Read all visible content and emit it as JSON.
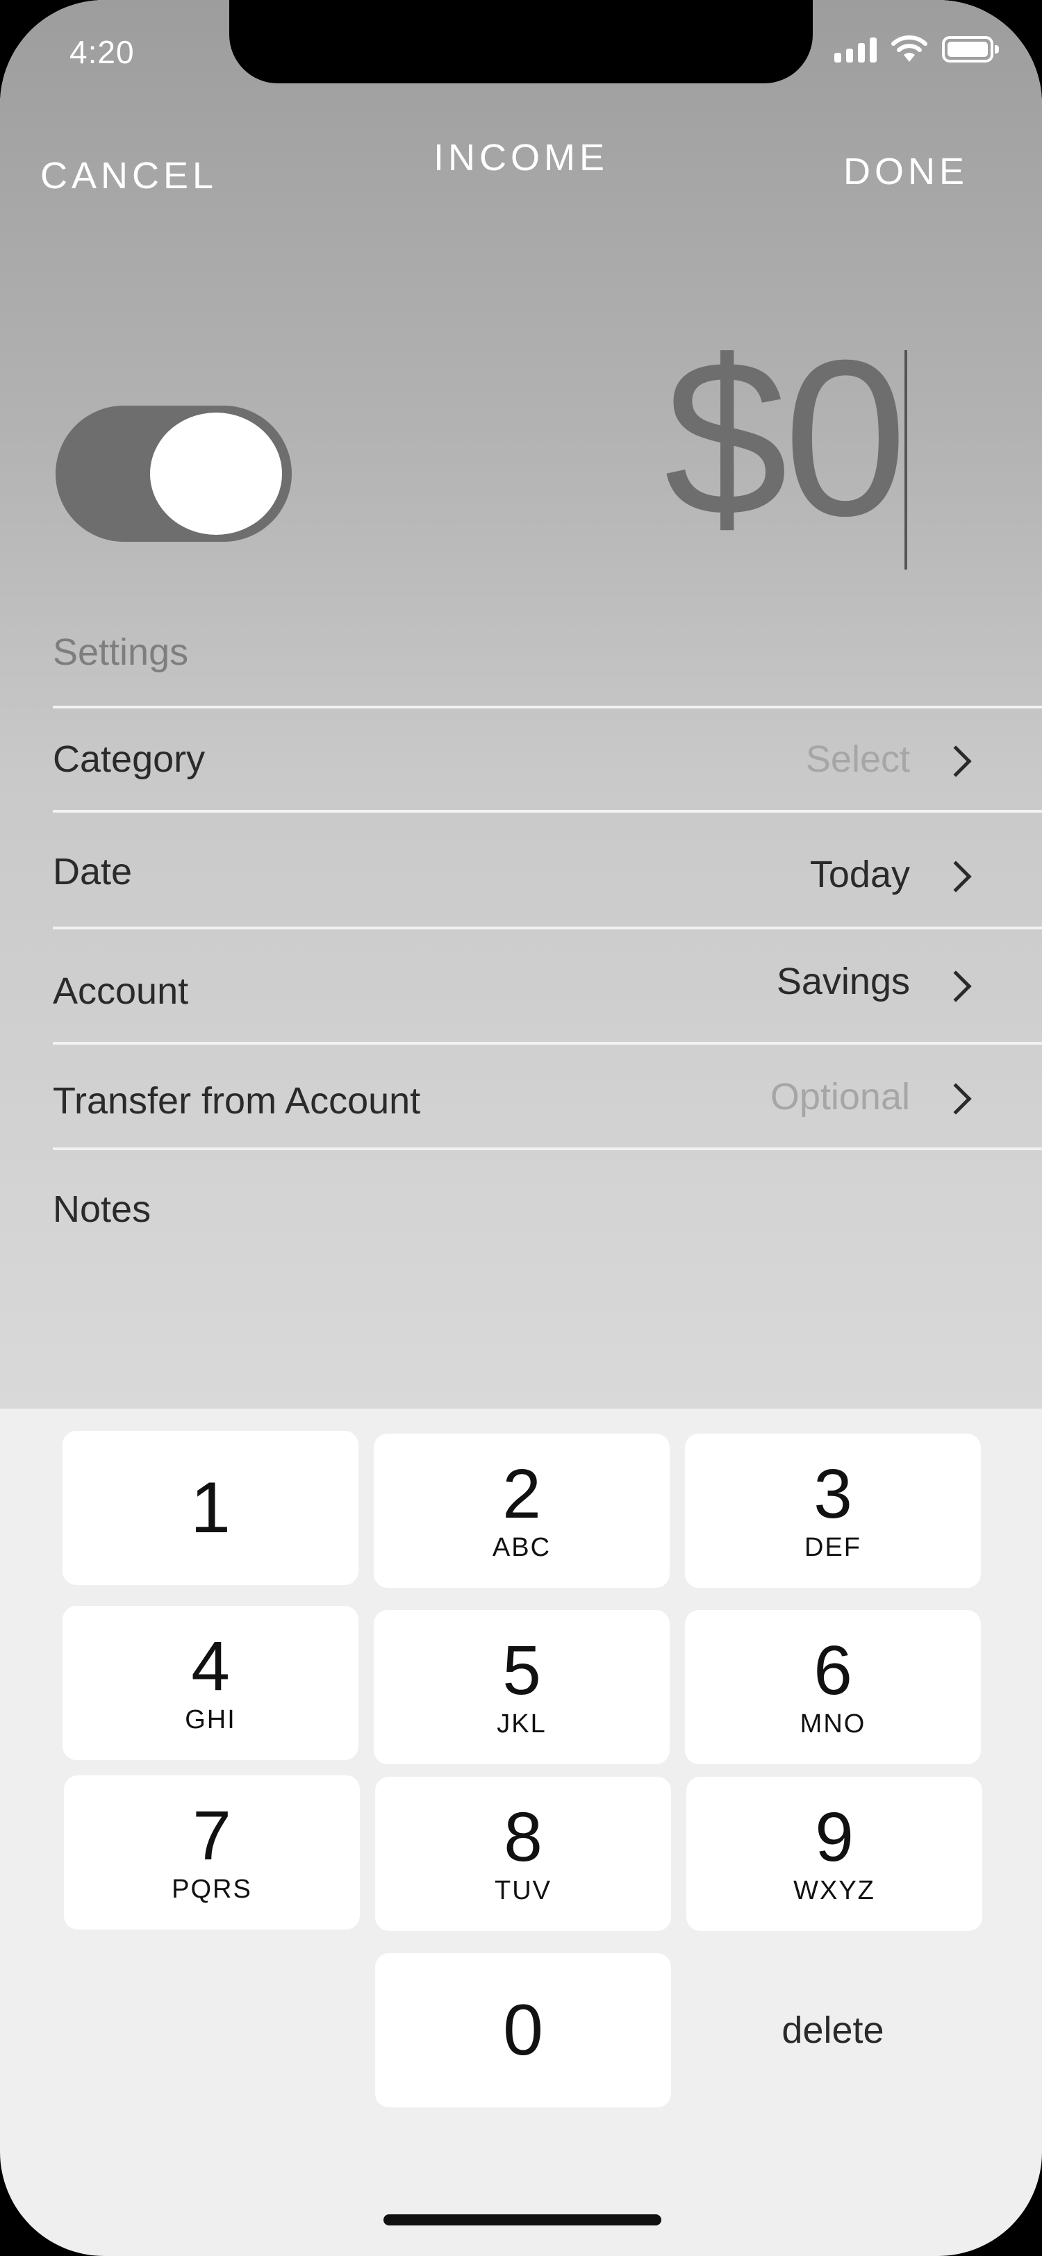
{
  "status_bar": {
    "time": "4:20",
    "icons": [
      "signal-icon",
      "wifi-icon",
      "battery-icon"
    ]
  },
  "header": {
    "cancel": "CANCEL",
    "title": "INCOME",
    "done": "DONE"
  },
  "toggle": {
    "state": "on"
  },
  "amount": "$0",
  "settings": {
    "label": "Settings",
    "rows": [
      {
        "label": "Category",
        "value": "Select",
        "placeholder": true
      },
      {
        "label": "Date",
        "value": "Today",
        "placeholder": false
      },
      {
        "label": "Account",
        "value": "Savings",
        "placeholder": false
      },
      {
        "label": "Transfer from Account",
        "value": "Optional",
        "placeholder": true
      }
    ],
    "notes_label": "Notes"
  },
  "keypad": {
    "keys": [
      {
        "num": "1",
        "letters": ""
      },
      {
        "num": "2",
        "letters": "ABC"
      },
      {
        "num": "3",
        "letters": "DEF"
      },
      {
        "num": "4",
        "letters": "GHI"
      },
      {
        "num": "5",
        "letters": "JKL"
      },
      {
        "num": "6",
        "letters": "MNO"
      },
      {
        "num": "7",
        "letters": "PQRS"
      },
      {
        "num": "8",
        "letters": "TUV"
      },
      {
        "num": "9",
        "letters": "WXYZ"
      },
      {
        "num": "0",
        "letters": ""
      }
    ],
    "delete": "delete"
  },
  "colors": {
    "header_text": "#ffffff",
    "toggle_track": "#6e6e6e",
    "keypad_bg": "#f0eff0"
  }
}
